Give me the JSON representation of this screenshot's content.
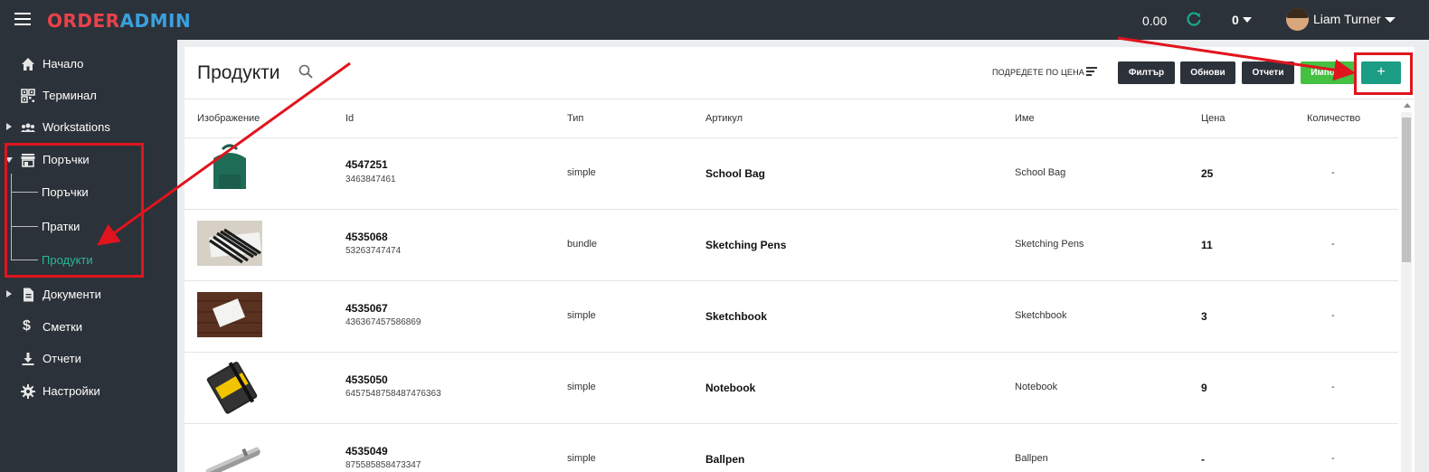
{
  "app": {
    "logo_part1": "ORDER",
    "logo_part2": "ADMIN",
    "balance": "0.00",
    "count": "0",
    "user_name": "Liam Turner"
  },
  "sidebar": {
    "items": [
      {
        "label": "Начало",
        "icon": "home-icon"
      },
      {
        "label": "Терминал",
        "icon": "qr-icon"
      },
      {
        "label": "Workstations",
        "icon": "users-icon"
      },
      {
        "label": "Поръчки",
        "icon": "store-icon"
      },
      {
        "label": "Документи",
        "icon": "document-icon"
      },
      {
        "label": "Сметки",
        "icon": "dollar-icon"
      },
      {
        "label": "Отчети",
        "icon": "download-icon"
      },
      {
        "label": "Настройки",
        "icon": "gear-icon"
      }
    ],
    "subitems": [
      {
        "label": "Поръчки"
      },
      {
        "label": "Пратки"
      },
      {
        "label": "Продукти",
        "active": true
      }
    ]
  },
  "page": {
    "title": "Продукти",
    "sort_label": "ПОДРЕДЕТЕ ПО ЦЕНА",
    "buttons": {
      "filter": "Филтър",
      "refresh": "Обнови",
      "reports": "Отчети",
      "import": "Импорт",
      "add": "+"
    }
  },
  "table": {
    "columns": [
      "Изображение",
      "Id",
      "Тип",
      "Артикул",
      "Име",
      "Цена",
      "Количество"
    ],
    "rows": [
      {
        "id": "4547251",
        "barcode": "3463847461",
        "type": "simple",
        "article": "School Bag",
        "name": "School Bag",
        "price": "25",
        "quantity": "-",
        "image": "backpack"
      },
      {
        "id": "4535068",
        "barcode": "53263747474",
        "type": "bundle",
        "article": "Sketching Pens",
        "name": "Sketching Pens",
        "price": "11",
        "quantity": "-",
        "image": "pens"
      },
      {
        "id": "4535067",
        "barcode": "436367457586869",
        "type": "simple",
        "article": "Sketchbook",
        "name": "Sketchbook",
        "price": "3",
        "quantity": "-",
        "image": "sketchbook"
      },
      {
        "id": "4535050",
        "barcode": "6457548758487476363",
        "type": "simple",
        "article": "Notebook",
        "name": "Notebook",
        "price": "9",
        "quantity": "-",
        "image": "notebook"
      },
      {
        "id": "4535049",
        "barcode": "875585858473347",
        "type": "simple",
        "article": "Ballpen",
        "name": "Ballpen",
        "price": "-",
        "quantity": "-",
        "image": "ballpen"
      }
    ]
  },
  "colors": {
    "topbar": "#2c3239",
    "accent_teal": "#1a9d84",
    "import_green": "#44c042",
    "annotation_red": "#e0141e",
    "logo_red": "#e8424a",
    "logo_blue": "#3aa0de"
  }
}
